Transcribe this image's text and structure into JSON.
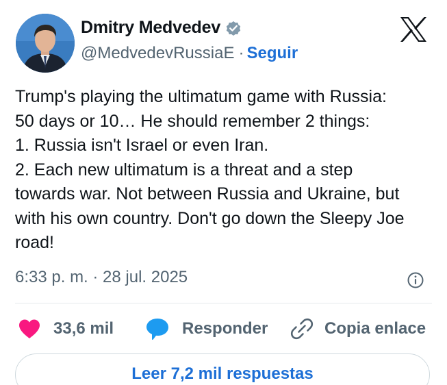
{
  "author": {
    "name": "Dmitry Medvedev",
    "handle": "@MedvedevRussiaE",
    "separator": "·",
    "follow_label": "Seguir"
  },
  "tweet": {
    "lines": [
      "Trump's playing the ultimatum game with Russia:",
      "50 days or 10… He should remember 2 things:",
      "1. Russia isn't Israel or even Iran.",
      "2. Each new ultimatum is a threat and a step",
      "towards war. Not between Russia and Ukraine, but",
      "with his own country. Don't go down the Sleepy Joe",
      "road!"
    ],
    "timestamp": "6:33 p. m. · 28 jul. 2025"
  },
  "actions": {
    "likes_count": "33,6 mil",
    "reply_label": "Responder",
    "copy_link_label": "Copia enlace"
  },
  "footer": {
    "read_replies_label": "Leer 7,2 mil respuestas"
  },
  "icons": {
    "verified": "verified-badge-icon",
    "brand": "x-logo-icon",
    "info": "info-icon",
    "like": "heart-icon",
    "reply": "speech-bubble-icon",
    "copy": "link-icon"
  },
  "colors": {
    "accent": "#1d6fd6",
    "like": "#f91880",
    "muted_text": "#536471",
    "text": "#0f1419",
    "verified_badge": "#829aab"
  }
}
